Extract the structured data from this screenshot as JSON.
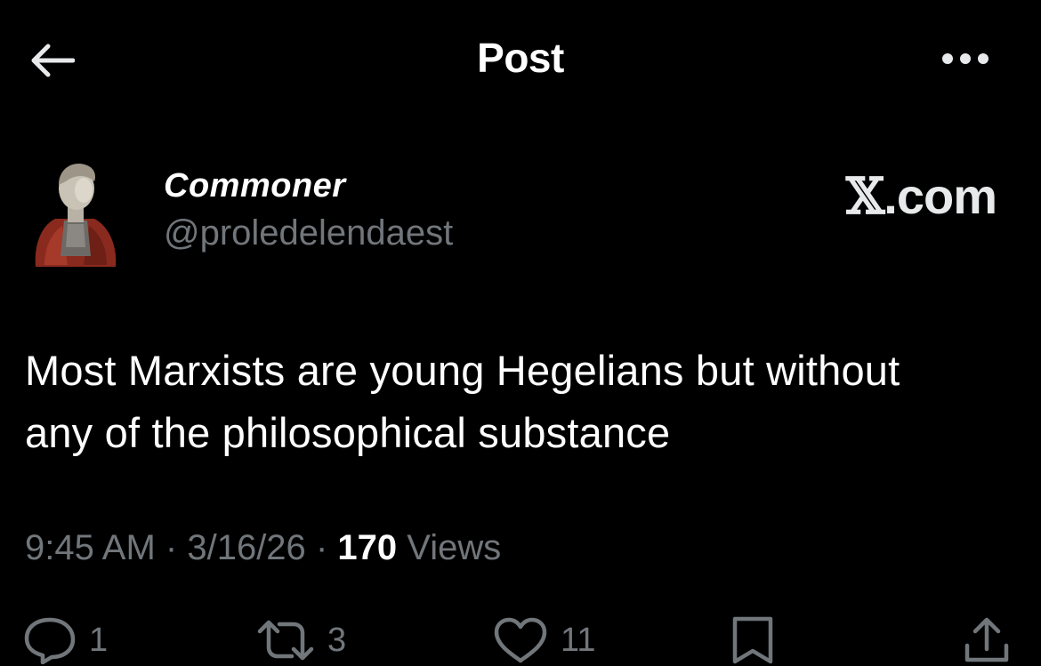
{
  "header": {
    "title": "Post",
    "back_icon": "arrow-left-icon",
    "more_icon": "more-dots-icon"
  },
  "author": {
    "display_name": "Commoner",
    "handle": "@proledelendaest",
    "avatar": "bust-statue-avatar"
  },
  "watermark": {
    "x_glyph": "𝕏",
    "domain": ".com"
  },
  "post": {
    "text_line1": "Most Marxists are young Hegelians but without",
    "text_line2": "any of the philosophical substance"
  },
  "meta": {
    "time": "9:45 AM",
    "date": "3/16/26",
    "separator": "·",
    "views_count": "170",
    "views_label": "Views"
  },
  "actions": {
    "replies": "1",
    "reposts": "3",
    "likes": "11"
  },
  "colors": {
    "background": "#000000",
    "text": "#ffffff",
    "muted": "#71767b"
  }
}
